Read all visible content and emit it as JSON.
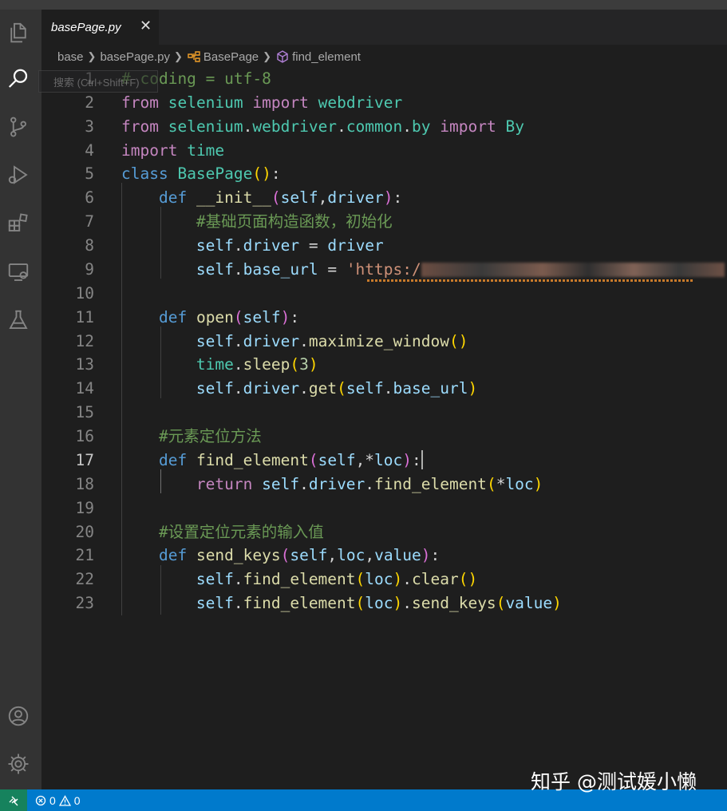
{
  "tab": {
    "filename": "basePage.py",
    "close_glyph": "✕"
  },
  "breadcrumb": {
    "folder": "base",
    "file": "basePage.py",
    "class": "BasePage",
    "method": "find_element"
  },
  "search_ghost": "搜索 (Ctrl+Shift+F)",
  "editor": {
    "current_line": 17,
    "line_numbers": [
      "1",
      "2",
      "3",
      "4",
      "5",
      "6",
      "7",
      "8",
      "9",
      "10",
      "11",
      "12",
      "13",
      "14",
      "15",
      "16",
      "17",
      "18",
      "19",
      "20",
      "21",
      "22",
      "23"
    ],
    "url_prefix": "'https:/",
    "url_suffix": "'"
  },
  "status": {
    "errors": "0",
    "warnings": "0"
  },
  "watermark": "知乎 @测试媛小懒",
  "colors": {
    "accent": "#007acc",
    "editor_bg": "#1e1e1e",
    "activity_bg": "#333333",
    "remote": "#16825d"
  }
}
